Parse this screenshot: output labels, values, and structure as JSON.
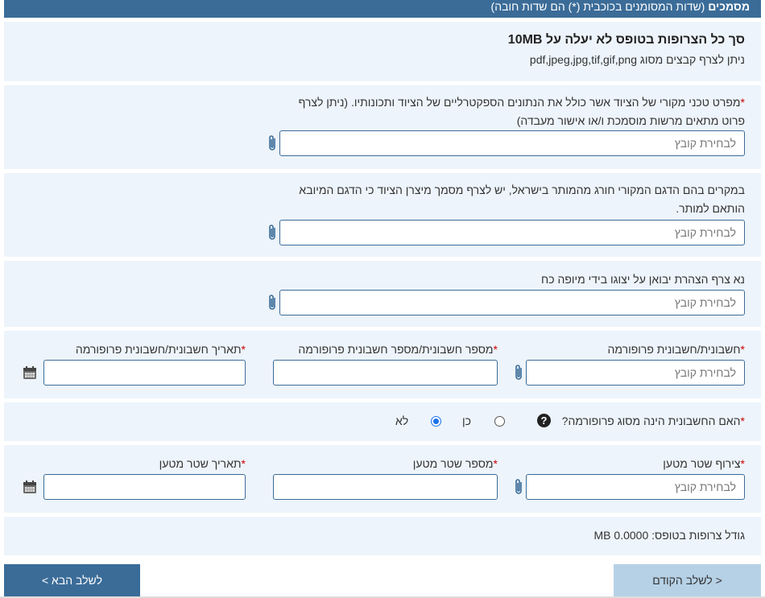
{
  "header": {
    "title": "מסמכים",
    "subtitle": "(שדות המסומנים בכוכבית (*) הם שדות חובה)"
  },
  "info": {
    "title": "סך כל הצרופות בטופס לא יעלה על 10MB",
    "subtitle": "ניתן לצרף קבצים מסוג pdf,jpeg,jpg,tif,gif,png"
  },
  "file_placeholder": "לבחירת קובץ",
  "fields": {
    "spec": {
      "label_line1": "מפרט טכני מקורי של הציוד אשר כולל את הנתונים הספקטרליים של הציוד ותכונותיו. (ניתן לצרף",
      "label_line2": "פרוט מתאים מרשות מוסמכת ו/או אישור מעבדה)"
    },
    "manufacturer_doc": {
      "label_line1": "במקרים בהם הדגם המקורי חורג מהמותר בישראל, יש לצרף מסמך מיצרן הציוד כי הדגם המיובא",
      "label_line2": "הותאם למותר."
    },
    "declaration": {
      "label": "נא צרף הצהרת יבואן על יצוגו בידי מיופה כח"
    },
    "invoice": {
      "file_label": "חשבונית/חשבונית פרופורמה",
      "number_label": "מספר חשבונית/מספר חשבונית פרופורמה",
      "date_label": "תאריך חשבונית/חשבונית פרופורמה"
    },
    "proforma_question": {
      "label": "האם החשבונית הינה מסוג פרופורמה?",
      "yes": "כן",
      "no": "לא",
      "selected": "לא"
    },
    "bill_of_lading": {
      "file_label": "צירוף שטר מטען",
      "number_label": "מספר שטר מטען",
      "date_label": "תאריך שטר מטען"
    }
  },
  "attachments_size": {
    "label": "גודל צרופות בטופס:",
    "value": "0.0000 MB"
  },
  "buttons": {
    "prev": "< לשלב הקודם",
    "next": "לשלב הבא >"
  },
  "required_marker": "*"
}
